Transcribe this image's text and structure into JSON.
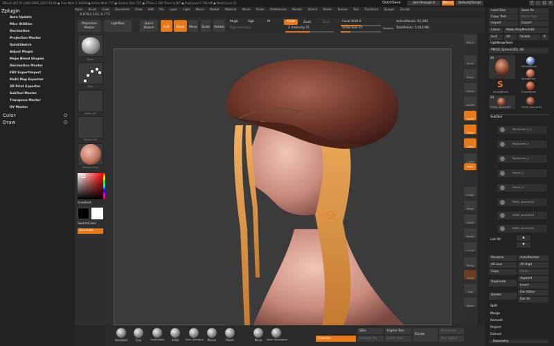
{
  "titlebar": {
    "text": "ZBrush 4R7 P3 (x64)   DSK1_2015-10-04   ● Free Mem 1.316GB ● Active Mem 777 ● Scratch Disk 757 ● ZTime 1.194 Timer 0.287 ● PolyCount 5.784 MP ● MeshCount 11",
    "quicksave": "QuickSave",
    "seethrough": "See-through  0",
    "menus": "Menus",
    "default_zscript": "DefaultZScript",
    "win_buttons": [
      "?",
      "-",
      "□",
      "×"
    ]
  },
  "menubar": [
    "Alpha",
    "Brush",
    "Color",
    "Document",
    "Draw",
    "Edit",
    "File",
    "Layer",
    "Light",
    "Macro",
    "Marker",
    "Material",
    "Movie",
    "Picker",
    "Preferences",
    "Render",
    "Stencil",
    "Stroke",
    "Texture",
    "Tool",
    "Transform",
    "Zplugin",
    "Zscript"
  ],
  "coords": "-0.678,0.193,-0.773",
  "left_tray": {
    "header": "Zplugin",
    "plugins": [
      "Auto Update",
      "Misc Utilities",
      "Decimation",
      "Projection Master",
      "QuickSketch",
      "Adjust Plugin",
      "Maya Blend Shapes",
      "Decimation Master",
      "FBX ExportImport",
      "Multi Map Exporter",
      "3D Print Exporter",
      "SubTool Master",
      "Transpose Master",
      "UV Master"
    ],
    "sections": [
      "Color",
      "Draw"
    ]
  },
  "toolbar": {
    "projection_master": "Projection\nMaster",
    "lightbox": "LightBox",
    "quick_sketch": "Quick\nSketch",
    "edit": "Edit",
    "draw": "Draw",
    "move": "Move",
    "scale": "Scale",
    "rotate": "Rotate",
    "mrgb": "Mrgb",
    "rgb": "Rgb",
    "m": "M",
    "rgb_intensity": "Rgb Intensity",
    "zadd": "Zadd",
    "zsub": "Zsub",
    "zcut": "Zcut",
    "z_intensity": "Z Intensity 51",
    "focal_shift": "Focal Shift 0",
    "draw_size": "Draw Size 37",
    "dynamic": "Dynamic",
    "active_points": "ActivePoints: 52,195",
    "total_points": "TotalPoints: 5.616 Mil"
  },
  "left_shelf": {
    "thumb_labels": [
      "Move",
      "Dots",
      "Alpha Off",
      "Texture Off",
      "MatCap Gray"
    ],
    "gradient": "Gradient",
    "switch_color": "SwitchColor",
    "alternate": "Alternate",
    "colors": {
      "main": "#ff0000",
      "secondary": "#ffffff"
    }
  },
  "right_shelf": [
    "SPix 3",
    "Scroll",
    "Zoom",
    "Actual",
    "AAHalf",
    "Persp",
    "Floor",
    "Local",
    "L.Sym",
    "Gxyz",
    "Frame",
    "Move",
    "Scale",
    "Rotate",
    "Line Fill PolyF",
    "Transp",
    "Ghost",
    "Solo",
    "Xpose"
  ],
  "right_tray": {
    "load_tool": "Load Tool",
    "save_as": "Save As",
    "copy_tool": "Copy Tool",
    "paste_tool": "Paste Tool",
    "import": "Import",
    "export": "Export",
    "clone": "Clone",
    "make_polymesh": "Make PolyMesh3D",
    "goz": "GoZ",
    "all": "All",
    "visible": "Visible",
    "r": "R",
    "lightbox_tools": "Lightbox▸Tools",
    "current_tool": "PM3D_Sphere3DL  48",
    "tool_thumbs": [
      "24",
      "SphereBrush",
      "AlphaBrush",
      "SimpleBrush",
      "EraserBrush",
      "24",
      "PM3D_Sphere3D",
      "PM3D_Sphere3D"
    ],
    "subtool_header": "SubTool",
    "subtools": [
      "PolySphere_1_1",
      "PolySphere_3",
      "PolySphere_1",
      "Plane1_5",
      "Plane1_4",
      "PM3D_Sphere3D4",
      "PM3D_Sphere3D3",
      "PM3D_Sphere3D2"
    ],
    "list_all": "List All",
    "rename": "Rename",
    "autoreorder": "AutoReorder",
    "all_low": "All Low",
    "all_high": "All High",
    "copy": "Copy",
    "paste": "Paste",
    "append": "Append",
    "duplicate": "Duplicate",
    "insert": "Insert",
    "delete": "Delete",
    "del_other": "Del Other",
    "del_all": "Del All",
    "split": "Split",
    "merge": "Merge",
    "remesh": "Remesh",
    "project": "Project",
    "extract": "Extract",
    "geometry": "Geometry"
  },
  "bottom_bar": {
    "brushes": [
      "Standard",
      "Clay",
      "ClayBuildup",
      "Inflat",
      "Dam_Standard",
      "Planar",
      "Polish",
      "Move",
      "Move Topological"
    ],
    "colorize": "Colorize",
    "sdiv": "SDiv",
    "smooth_uv": "Smooth UV",
    "lower_res": "Lower Res",
    "higher_res": "Higher Res",
    "divide": "Divide",
    "del_lower": "Del Lower",
    "del_higher": "Del Higher"
  }
}
